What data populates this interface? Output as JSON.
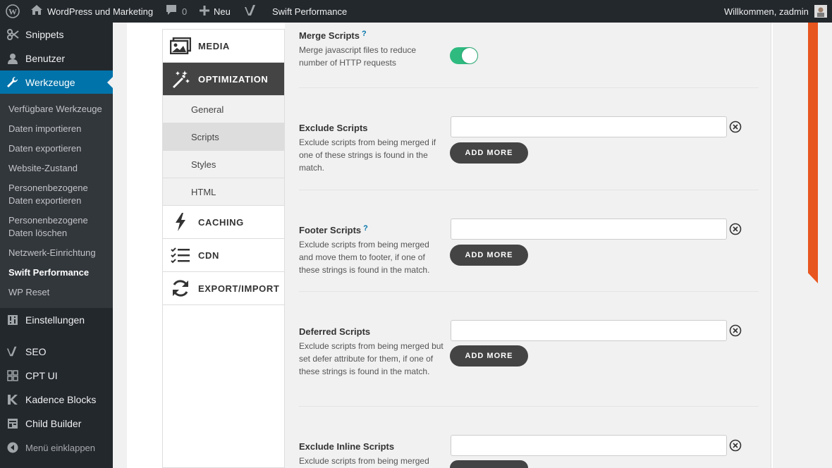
{
  "adminbar": {
    "site_name": "WordPress und Marketing",
    "comments_count": "0",
    "new_label": "Neu",
    "plugin_label": "Swift Performance",
    "greeting": "Willkommen, zadmin"
  },
  "sidebar": {
    "top_items": [
      {
        "label": "Snippets",
        "icon": "snippets-icon"
      },
      {
        "label": "Benutzer",
        "icon": "user-icon"
      },
      {
        "label": "Werkzeuge",
        "icon": "wrench-icon"
      }
    ],
    "submenu": [
      "Verfügbare Werkzeuge",
      "Daten importieren",
      "Daten exportieren",
      "Website-Zustand",
      "Personenbezogene Daten exportieren",
      "Personenbezogene Daten löschen",
      "Netzwerk-Einrichtung",
      "Swift Performance",
      "WP Reset"
    ],
    "bottom_items": [
      {
        "label": "Einstellungen",
        "icon": "settings-icon"
      },
      {
        "label": "SEO",
        "icon": "yoast-icon"
      },
      {
        "label": "CPT UI",
        "icon": "cpt-icon"
      },
      {
        "label": "Kadence Blocks",
        "icon": "kadence-icon"
      },
      {
        "label": "Child Builder",
        "icon": "child-builder-icon"
      },
      {
        "label": "Menü einklappen",
        "icon": "collapse-icon"
      }
    ]
  },
  "tabs": {
    "media": "MEDIA",
    "optimization": "OPTIMIZATION",
    "subtabs": [
      "General",
      "Scripts",
      "Styles",
      "HTML"
    ],
    "caching": "CACHING",
    "cdn": "CDN",
    "export_import": "EXPORT/IMPORT"
  },
  "settings": {
    "merge_scripts": {
      "title": "Merge Scripts",
      "help": "?",
      "desc": "Merge javascript files to reduce number of HTTP requests",
      "enabled": true
    },
    "exclude_scripts": {
      "title": "Exclude Scripts",
      "desc": "Exclude scripts from being merged if one of these strings is found in the match.",
      "value": ""
    },
    "footer_scripts": {
      "title": "Footer Scripts",
      "help": "?",
      "desc": "Exclude scripts from being merged and move them to footer, if one of these strings is found in the match.",
      "value": ""
    },
    "deferred_scripts": {
      "title": "Deferred Scripts",
      "desc": "Exclude scripts from being merged but set defer attribute for them, if one of these strings is found in the match.",
      "value": ""
    },
    "exclude_inline_scripts": {
      "title": "Exclude Inline Scripts",
      "desc": "Exclude scripts from being merged",
      "value": ""
    },
    "add_more_label": "ADD MORE"
  },
  "colors": {
    "adminbar": "#23282d",
    "accent": "#0073aa",
    "toggle_on": "#2fba80",
    "brand_orange": "#e8561f"
  }
}
